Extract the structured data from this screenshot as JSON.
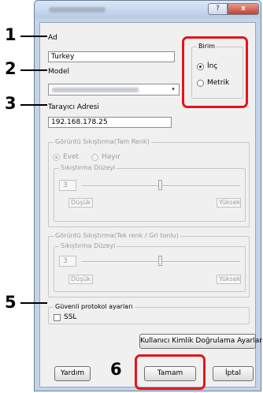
{
  "window": {
    "help_glyph": "?",
    "close_glyph": "x"
  },
  "fields": {
    "name_label": "Ad",
    "name_value": "Turkey",
    "model_label": "Model",
    "scanner_address_label": "Tarayıcı Adresi",
    "scanner_address_value": "192.168.178.25"
  },
  "unit": {
    "group_label": "Birim",
    "options": [
      {
        "label": "İnç",
        "selected": true
      },
      {
        "label": "Metrik",
        "selected": false
      }
    ]
  },
  "compression_full_color": {
    "group_label": "Görüntü Sıkıştırma(Tam Renk)",
    "options": [
      {
        "label": "Evet",
        "selected": true
      },
      {
        "label": "Hayır",
        "selected": false
      }
    ],
    "level_label": "Sıkıştırma Düzeyi",
    "level_value": "3",
    "low_label": "Düşük",
    "high_label": "Yüksek"
  },
  "compression_mono": {
    "group_label": "Görüntü Sıkıştırma(Tek renk / Gri tonlu)",
    "level_label": "Sıkıştırma Düzeyi",
    "level_value": "3",
    "low_label": "Düşük",
    "high_label": "Yüksek"
  },
  "secure_protocol": {
    "group_label": "Güvenli protokol ayarları",
    "ssl_label": "SSL",
    "ssl_checked": false
  },
  "buttons": {
    "auth_settings": "Kullanıcı Kimlik Doğrulama Ayarları",
    "help": "Yardım",
    "ok": "Tamam",
    "cancel": "İptal"
  },
  "callouts": [
    "1",
    "2",
    "3",
    "5",
    "6"
  ],
  "colors": {
    "highlight": "#e3161b"
  }
}
